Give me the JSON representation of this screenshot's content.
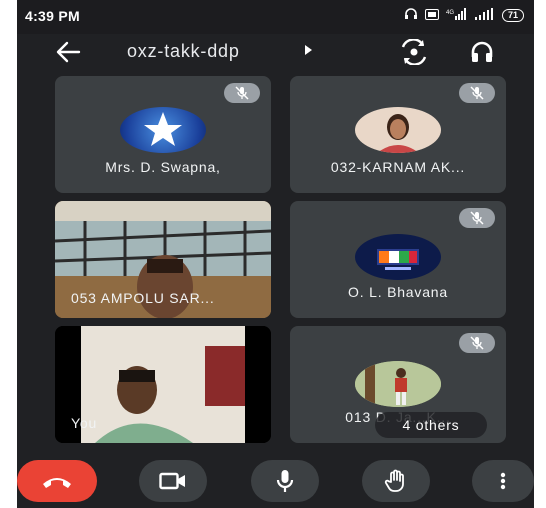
{
  "status_bar": {
    "time": "4:39 PM",
    "battery": "71",
    "network_label": "4G"
  },
  "header": {
    "meeting_code": "oxz-takk-ddp"
  },
  "participants": [
    {
      "name": "Mrs. D. Swapna,",
      "muted": true
    },
    {
      "name": "032-KARNAM AK...",
      "muted": true
    },
    {
      "name": "053 AMPOLU SAR...",
      "muted": false
    },
    {
      "name": "O. L. Bhavana",
      "muted": true
    },
    {
      "name": "You",
      "muted": false
    },
    {
      "name": "013 D. Ja...K...",
      "muted": true
    }
  ],
  "others_chip": "4 others",
  "colors": {
    "end_call": "#ea4335",
    "tile_bg": "#3c4043",
    "background": "#202124"
  },
  "icons": [
    "back-arrow-icon",
    "switch-camera-icon",
    "headphones-icon",
    "mic-off-icon",
    "end-call-icon",
    "camera-icon",
    "mic-icon",
    "raise-hand-icon",
    "more-vert-icon"
  ]
}
